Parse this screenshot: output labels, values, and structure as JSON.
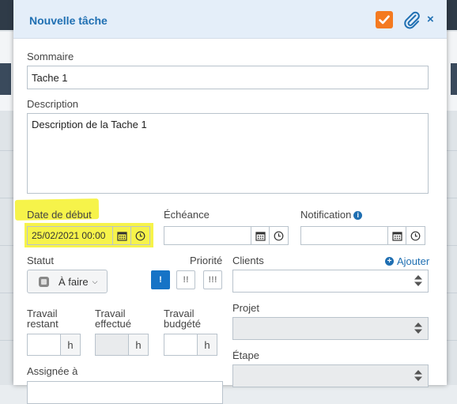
{
  "dialog": {
    "title": "Nouvelle tâche",
    "close_label": "×"
  },
  "form": {
    "summary": {
      "label": "Sommaire",
      "value": "Tache 1"
    },
    "description": {
      "label": "Description",
      "value": "Description de la Tache 1"
    },
    "start_date": {
      "label": "Date de début",
      "value": "25/02/2021 00:00"
    },
    "due_date": {
      "label": "Échéance",
      "value": ""
    },
    "notification": {
      "label": "Notification",
      "value": ""
    },
    "status": {
      "label": "Statut",
      "value": "À faire"
    },
    "priority": {
      "label": "Priorité",
      "options": [
        "!",
        "!!",
        "!!!"
      ],
      "selected": "!"
    },
    "clients": {
      "label": "Clients",
      "add_label": "Ajouter"
    },
    "project": {
      "label": "Projet"
    },
    "stage": {
      "label": "Étape"
    },
    "work_remaining": {
      "label_line1": "Travail",
      "label_line2": "restant",
      "unit": "h"
    },
    "work_done": {
      "label_line1": "Travail",
      "label_line2": "effectué",
      "unit": "h"
    },
    "work_budgeted": {
      "label_line1": "Travail",
      "label_line2": "budgété",
      "unit": "h"
    },
    "assigned": {
      "label": "Assignée à"
    }
  },
  "colors": {
    "accent": "#1f6fb2",
    "check_orange": "#f47a20",
    "highlight": "#f6f34a",
    "priority_active": "#1673c6"
  }
}
